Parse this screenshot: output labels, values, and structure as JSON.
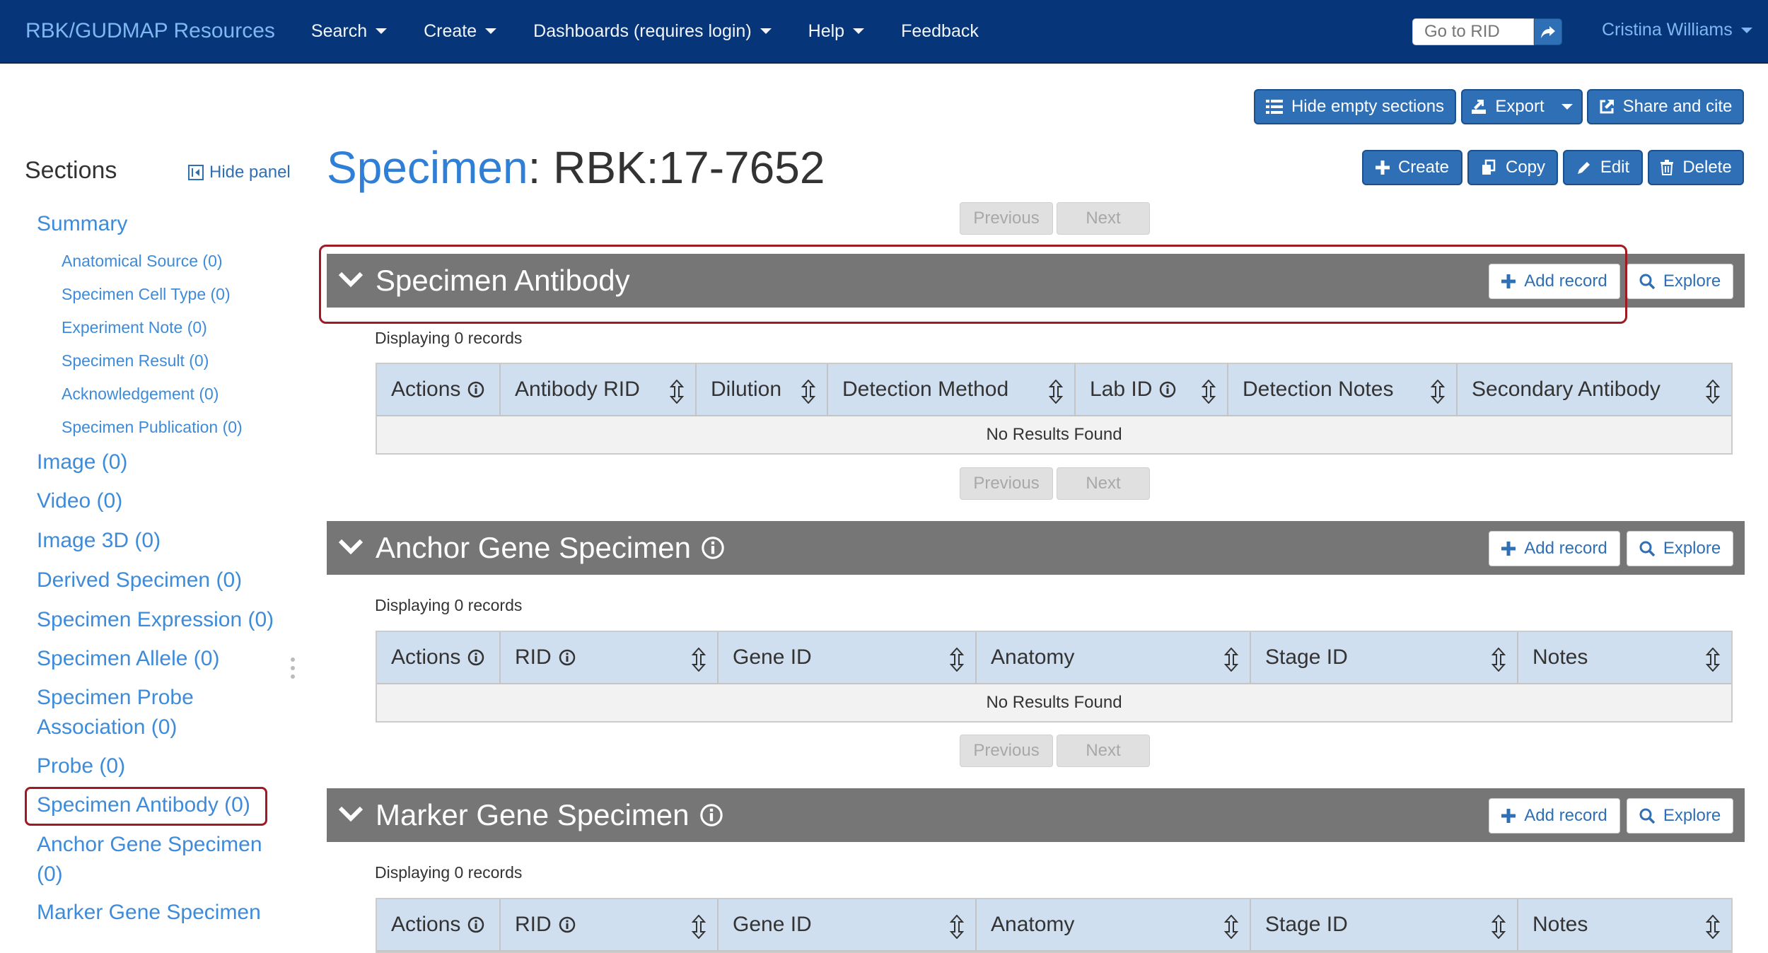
{
  "navbar": {
    "brand": "RBK/GUDMAP Resources",
    "items": [
      {
        "label": "Search"
      },
      {
        "label": "Create"
      },
      {
        "label": "Dashboards (requires login)"
      },
      {
        "label": "Help"
      },
      {
        "label": "Feedback"
      }
    ],
    "rid_placeholder": "Go to RID",
    "user": "Cristina Williams"
  },
  "toolbar": {
    "hide_empty": "Hide empty sections",
    "export": "Export",
    "share": "Share and cite",
    "create": "Create",
    "copy": "Copy",
    "edit": "Edit",
    "delete": "Delete"
  },
  "sidebar": {
    "title": "Sections",
    "hide_panel": "Hide panel",
    "summary": "Summary",
    "sub_items": [
      "Anatomical Source (0)",
      "Specimen Cell Type (0)",
      "Experiment Note (0)",
      "Specimen Result (0)",
      "Acknowledgement (0)",
      "Specimen Publication (0)"
    ],
    "main_items": [
      "Image (0)",
      "Video (0)",
      "Image 3D (0)",
      "Derived Specimen (0)",
      "Specimen Expression (0)",
      "Specimen Allele (0)",
      "Specimen Probe",
      "Association (0)",
      "Probe (0)",
      "Specimen Antibody (0)",
      "Anchor Gene Specimen",
      "(0)",
      "Marker Gene Specimen"
    ]
  },
  "page": {
    "table_name": "Specimen",
    "separator": ":",
    "record_id": "RBK:17-7652"
  },
  "pager": {
    "previous": "Previous",
    "next": "Next"
  },
  "sections": [
    {
      "title": "Specimen Antibody",
      "add": "Add record",
      "explore": "Explore",
      "displaying": "Displaying 0 records",
      "columns": [
        "Actions",
        "Antibody RID",
        "Dilution",
        "Detection Method",
        "Lab ID",
        "Detection Notes",
        "Secondary Antibody"
      ],
      "empty": "No Results Found"
    },
    {
      "title": "Anchor Gene Specimen",
      "add": "Add record",
      "explore": "Explore",
      "displaying": "Displaying 0 records",
      "columns": [
        "Actions",
        "RID",
        "Gene ID",
        "Anatomy",
        "Stage ID",
        "Notes"
      ],
      "empty": "No Results Found"
    },
    {
      "title": "Marker Gene Specimen",
      "add": "Add record",
      "explore": "Explore",
      "displaying": "Displaying 0 records",
      "columns": [
        "Actions",
        "RID",
        "Gene ID",
        "Anatomy",
        "Stage ID",
        "Notes"
      ]
    }
  ]
}
